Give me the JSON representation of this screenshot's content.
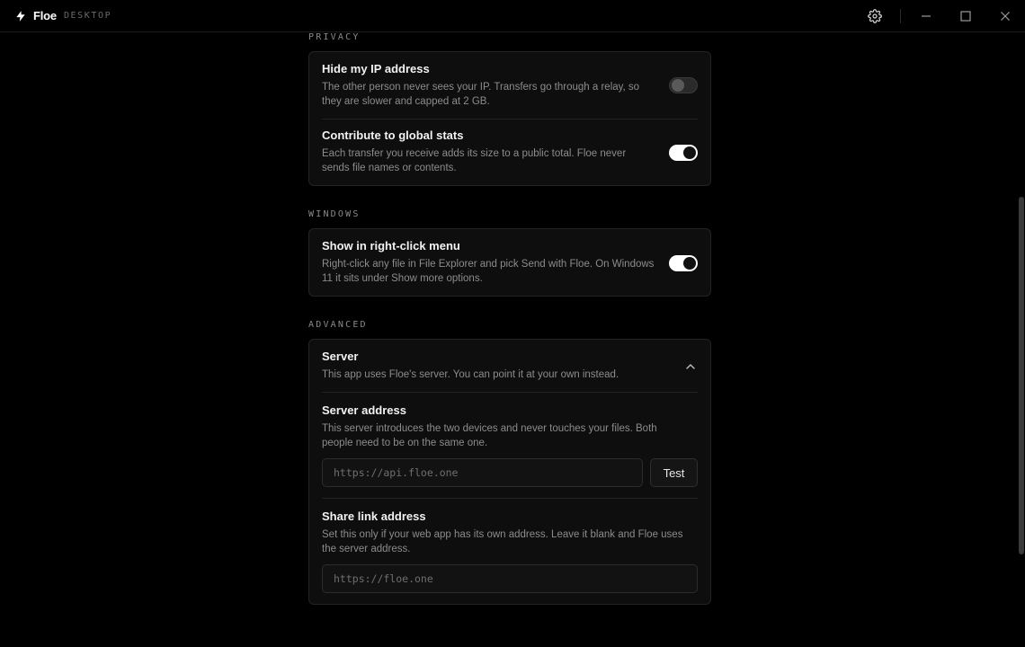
{
  "app": {
    "name": "Floe",
    "tag": "DESKTOP"
  },
  "titlebar": {
    "settings_icon": "gear-icon",
    "minimize_icon": "minimize-icon",
    "maximize_icon": "maximize-icon",
    "close_icon": "close-icon"
  },
  "sections": {
    "privacy": {
      "label": "PRIVACY",
      "hide_ip": {
        "title": "Hide my IP address",
        "desc": "The other person never sees your IP. Transfers go through a relay, so they are slower and capped at 2 GB.",
        "enabled": false
      },
      "global_stats": {
        "title": "Contribute to global stats",
        "desc": "Each transfer you receive adds its size to a public total. Floe never sends file names or contents.",
        "enabled": true
      }
    },
    "windows": {
      "label": "WINDOWS",
      "context_menu": {
        "title": "Show in right-click menu",
        "desc": "Right-click any file in File Explorer and pick Send with Floe. On Windows 11 it sits under Show more options.",
        "enabled": true
      }
    },
    "advanced": {
      "label": "ADVANCED",
      "server": {
        "title": "Server",
        "desc": "This app uses Floe's server. You can point it at your own instead.",
        "expanded": true
      },
      "server_address": {
        "title": "Server address",
        "desc": "This server introduces the two devices and never touches your files. Both people need to be on the same one.",
        "placeholder": "https://api.floe.one",
        "test_label": "Test"
      },
      "share_link": {
        "title": "Share link address",
        "desc": "Set this only if your web app has its own address. Leave it blank and Floe uses the server address.",
        "placeholder": "https://floe.one"
      }
    }
  },
  "colors": {
    "background": "#000000",
    "card": "#0e0e0e",
    "toggle_on": "#ffffff"
  }
}
